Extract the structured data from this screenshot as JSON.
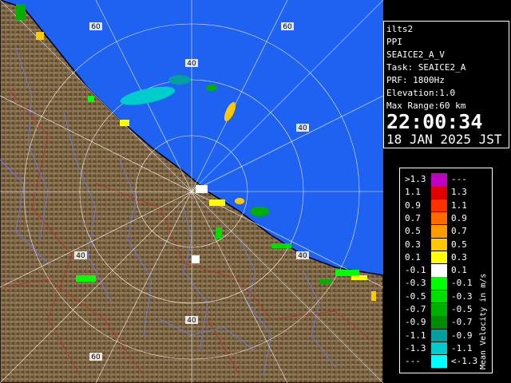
{
  "radar": {
    "ring_labels": [
      "60",
      "60",
      "40",
      "40",
      "40",
      "40",
      "40",
      "60"
    ],
    "colors": {
      "sea": "#1f61f0",
      "land": "#7a6446",
      "river": "#6c78d0",
      "border": "#b03a2a",
      "coast": "#000000",
      "grid": "#ffffff"
    }
  },
  "info": {
    "site": "ilts2",
    "mode": "PPI",
    "product": "SEAICE2_A_V",
    "task": "Task: SEAICE2_A",
    "prf": "PRF: 1800Hz",
    "elevation": "Elevation:1.0",
    "max_range": "Max Range:60 km",
    "time": "22:00:34",
    "date": "18 JAN 2025 JST"
  },
  "legend": {
    "title": "Mean Velocity in m/s",
    "rows": [
      {
        "left": ">1.3",
        "right": "---",
        "color": "#c000c0"
      },
      {
        "left": "1.1",
        "right": "1.3",
        "color": "#e00000"
      },
      {
        "left": "0.9",
        "right": "1.1",
        "color": "#ff3000"
      },
      {
        "left": "0.7",
        "right": "0.9",
        "color": "#ff6a00"
      },
      {
        "left": "0.5",
        "right": "0.7",
        "color": "#ff9a00"
      },
      {
        "left": "0.3",
        "right": "0.5",
        "color": "#ffc800"
      },
      {
        "left": "0.1",
        "right": "0.3",
        "color": "#ffff00"
      },
      {
        "left": "-0.1",
        "right": "0.1",
        "color": "#ffffff"
      },
      {
        "left": "-0.3",
        "right": "-0.1",
        "color": "#00ff00"
      },
      {
        "left": "-0.5",
        "right": "-0.3",
        "color": "#00dd00"
      },
      {
        "left": "-0.7",
        "right": "-0.5",
        "color": "#00b000"
      },
      {
        "left": "-0.9",
        "right": "-0.7",
        "color": "#008c00"
      },
      {
        "left": "-1.1",
        "right": "-0.9",
        "color": "#00a0a0"
      },
      {
        "left": "-1.3",
        "right": "-1.1",
        "color": "#00cccc"
      },
      {
        "left": "---",
        "right": "<-1.3",
        "color": "#00ffff"
      }
    ]
  }
}
